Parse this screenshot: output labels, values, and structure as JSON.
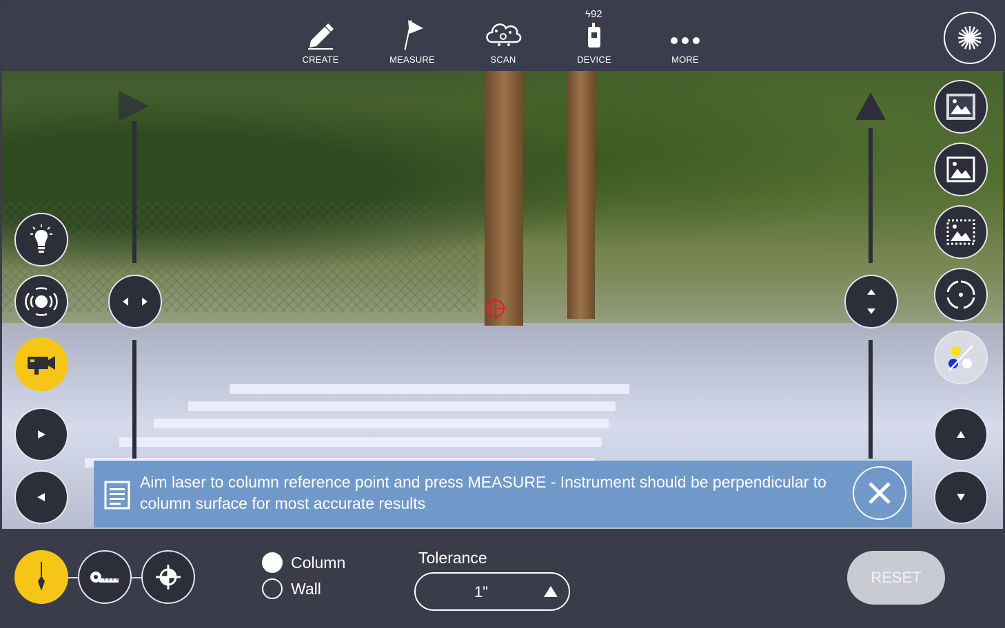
{
  "toolbar": {
    "items": [
      {
        "label": "CREATE",
        "icon": "pencil-icon"
      },
      {
        "label": "MEASURE",
        "icon": "flag-icon"
      },
      {
        "label": "SCAN",
        "icon": "cloud-scan-icon"
      },
      {
        "label": "DEVICE",
        "icon": "device-icon"
      },
      {
        "label": "MORE",
        "icon": "more-dots-icon"
      }
    ],
    "battery": "92",
    "battery_symbol": "ϟ",
    "laser_icon": "laser-starburst-icon"
  },
  "banner": {
    "message": "Aim laser to column reference point and press MEASURE - Instrument should be perpendicular to column surface for most accurate results",
    "close_symbol": "✕"
  },
  "options": {
    "target_types": [
      {
        "label": "Column",
        "selected": true
      },
      {
        "label": "Wall",
        "selected": false
      }
    ]
  },
  "tolerance": {
    "label": "Tolerance",
    "value": "1\""
  },
  "reset_label": "RESET",
  "colors": {
    "accent_yellow": "#f5c518",
    "banner_blue": "#7098c9",
    "crosshair_red": "#e0202a",
    "panel_dark": "#3a3c4a"
  }
}
